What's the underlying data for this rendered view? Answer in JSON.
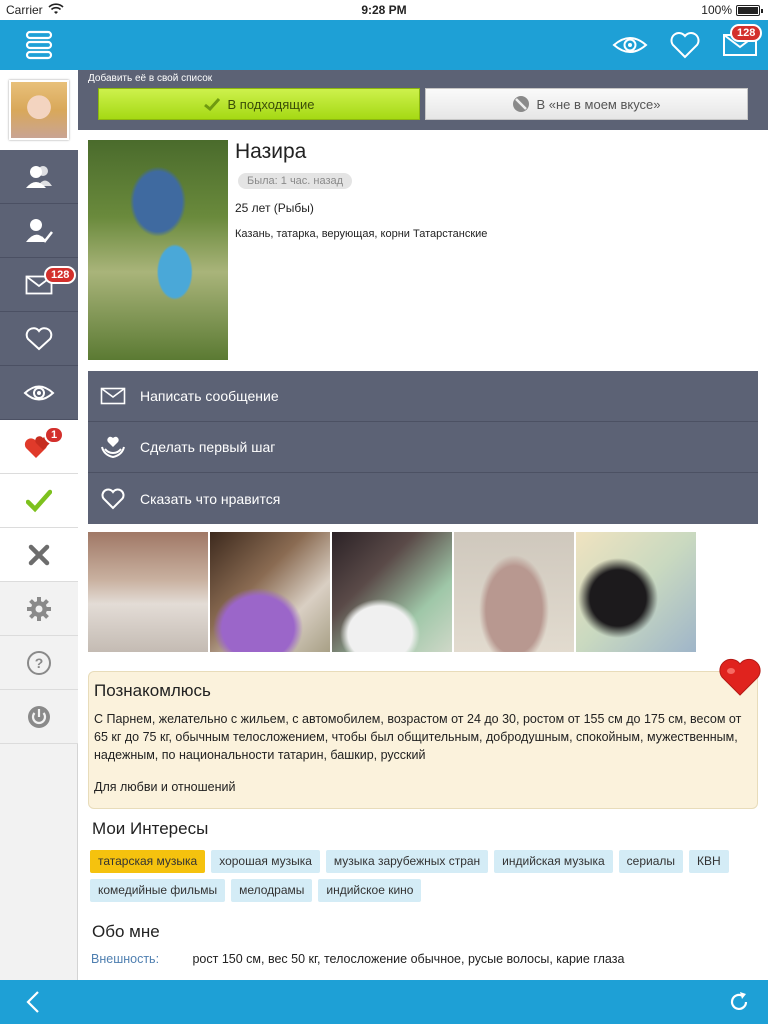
{
  "status_bar": {
    "carrier": "Carrier",
    "time": "9:28 PM",
    "battery": "100%"
  },
  "top_bar": {
    "messages_badge": "128"
  },
  "sidebar": {
    "items": [
      {
        "name": "people",
        "badge": ""
      },
      {
        "name": "visitors",
        "badge": ""
      },
      {
        "name": "messages",
        "badge": "128"
      },
      {
        "name": "likes",
        "badge": ""
      },
      {
        "name": "views",
        "badge": ""
      },
      {
        "name": "mutual-likes",
        "badge": "1"
      },
      {
        "name": "matches",
        "badge": ""
      },
      {
        "name": "not-my-type",
        "badge": ""
      },
      {
        "name": "settings",
        "badge": ""
      },
      {
        "name": "help",
        "badge": ""
      },
      {
        "name": "logout",
        "badge": ""
      }
    ]
  },
  "list_bar": {
    "title": "Добавить её в свой список",
    "match_label": "В подходящие",
    "not_my_type_label": "В «не в моем вкусе»"
  },
  "profile": {
    "name": "Назира",
    "last_seen": "Была: 1 час. назад",
    "age": "25 лет (Рыбы)",
    "info": "Казань, татарка, верующая, корни Татарстанские"
  },
  "actions": {
    "message": "Написать сообщение",
    "first_step": "Сделать первый шаг",
    "like": "Сказать что нравится"
  },
  "about": {
    "title": "Познакомлюсь",
    "text": "С Парнем, желательно с жильем, с автомобилем, возрастом от 24 до 30, ростом от 155 см до 175 см, весом от 65 кг до 75 кг, обычным телосложением, чтобы был общительным, добродушным, спокойным, мужественным, надежным, по национальности татарин, башкир, русский",
    "goal": "Для любви и отношений"
  },
  "interests": {
    "title": "Мои Интересы",
    "tags": [
      "татарская музыка",
      "хорошая музыка",
      "музыка зарубежных стран",
      "индийская музыка",
      "сериалы",
      "КВН",
      "комедийные фильмы",
      "мелодрамы",
      "индийское кино"
    ]
  },
  "about_me": {
    "title": "Обо мне",
    "appearance_label": "Внешность:",
    "appearance_value": "рост 150 см, вес 50 кг, телосложение обычное, русые волосы, карие глаза"
  },
  "colors": {
    "accent": "#1ea0d6",
    "sidebar_dark": "#5c6275",
    "match_green": "#a5d914",
    "badge_red": "#d3302c",
    "highlight_tag": "#f5c20e"
  }
}
